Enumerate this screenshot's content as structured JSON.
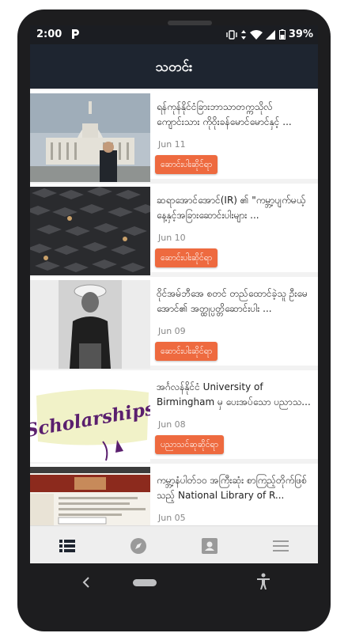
{
  "status": {
    "time": "2:00",
    "app_letter": "P",
    "battery": "39%"
  },
  "appbar": {
    "title": "သတင်း"
  },
  "articles": [
    {
      "title": "ရန်ကုန်နိုင်ငံခြားဘာသာတက္ကသိုလ်ကျောင်းသား ကိုဝိုးခန်မောင်မောင်နှင့် ...",
      "date": "Jun 11",
      "button": "ဆောင်းပါးဆိုင်ရာ",
      "image": "capitol-building-photo"
    },
    {
      "title": "ဆရာအောင်အောင်(IR) ၏ \"ကမ္ဘာ့ပျက်မယ့်နေ့နှင့်အခြားဆောင်းပါးများ ...",
      "date": "Jun 10",
      "button": "ဆောင်းပါးဆိုင်ရာ",
      "image": "graduation-caps-photo"
    },
    {
      "title": "ဝိုင်အမ်ဘီအေ စတင် တည်ထောင်ခဲ့သူ ဦးမေအောင်၏ အတ္ထုပ္ပတ္တိဆောင်းပါး ...",
      "date": "Jun 09",
      "button": "ဆောင်းပါးဆိုင်ရာ",
      "image": "historical-portrait-photo"
    },
    {
      "title": "အင်္ဂလန်နိုင်ငံ University of Birmingham မှ ပေးအပ်သော ပညာသ...",
      "date": "Jun 08",
      "button": "ပညာသင်ဆုဆိုင်ရာ",
      "image": "scholarships-graphic",
      "image_text": "Scholarships"
    },
    {
      "title": "ကမ္ဘာ့နံပါတ်၁၀ အကြီးဆုံး စာကြည့်တိုက်ဖြစ်သည့် National Library of R...",
      "date": "Jun 05",
      "button": "",
      "image": "library-website-screenshot"
    }
  ],
  "bottom_nav": [
    "list-icon",
    "compass-icon",
    "contact-icon",
    "menu-icon"
  ],
  "colors": {
    "appbar": "#1e2530",
    "button": "#ee6a3f",
    "background": "#f2f2f2"
  }
}
